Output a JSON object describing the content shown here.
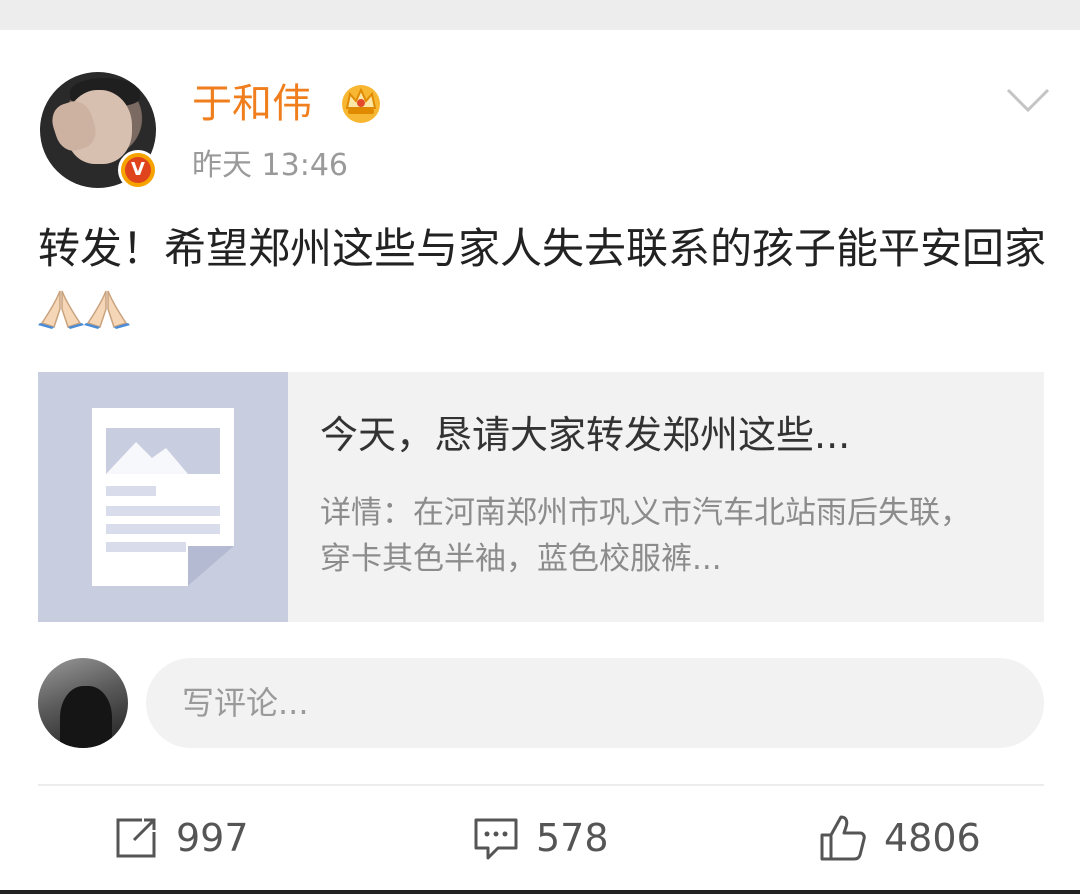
{
  "post": {
    "author": "于和伟",
    "timestamp": "昨天 13:46",
    "text": "转发！希望郑州这些与家人失去联系的孩子能平安回家"
  },
  "icons": {
    "author_badge": "verified-v-icon",
    "author_level": "crown-icon",
    "menu": "chevron-down-icon",
    "emoji": "praying-hands-icon",
    "link_thumb": "document-image-icon",
    "repost": "repost-icon",
    "comment": "comment-icon",
    "like": "thumbs-up-icon"
  },
  "badge": {
    "letter": "V"
  },
  "link_card": {
    "title": "今天，恳请大家转发郑州这些...",
    "description": "详情：在河南郑州市巩义市汽车北站雨后失联，穿卡其色半袖，蓝色校服裤..."
  },
  "comment_box": {
    "placeholder": "写评论..."
  },
  "actions": {
    "reposts": "997",
    "comments": "578",
    "likes": "4806"
  },
  "colors": {
    "author_name": "#f07e1d",
    "badge": "#f6a300",
    "thumb_bg": "#c8cde0"
  }
}
